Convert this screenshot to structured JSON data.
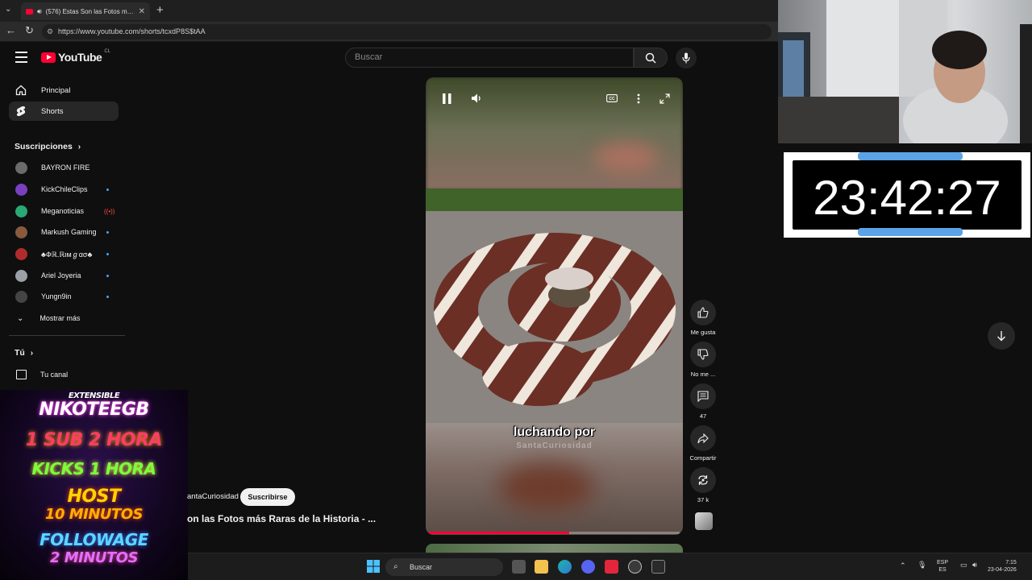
{
  "browser": {
    "tab_title": "(576) Estas Son las Fotos más Ra",
    "url": "https://www.youtube.com/shorts/tcxdP8S$tAA"
  },
  "header": {
    "logo_text": "YouTube",
    "country_code": "CL",
    "search_placeholder": "Buscar"
  },
  "sidebar": {
    "nav": [
      {
        "label": "Principal",
        "icon": "home-icon"
      },
      {
        "label": "Shorts",
        "icon": "shorts-icon",
        "active": true
      }
    ],
    "subscriptions_title": "Suscripciones",
    "subscriptions": [
      {
        "name": "BAYRON FIRE",
        "indicator": "none",
        "color": "#6b6b6b"
      },
      {
        "name": "KickChileClips",
        "indicator": "dot",
        "color": "#7a3fbf"
      },
      {
        "name": "Meganoticias",
        "indicator": "live",
        "color": "#2aa876"
      },
      {
        "name": "Markush Gaming",
        "indicator": "dot",
        "color": "#8a5a3c"
      },
      {
        "name": "♣Фℝ.ℝιмℊασ♣",
        "indicator": "dot",
        "color": "#b02c2c"
      },
      {
        "name": "Ariel Joyeria",
        "indicator": "dot",
        "color": "#9aa0a6"
      },
      {
        "name": "Yungn9in",
        "indicator": "dot",
        "color": "#444444"
      }
    ],
    "show_more": "Mostrar más",
    "you_title": "Tú",
    "your_channel": "Tu canal"
  },
  "promo": {
    "line1": "EXTENSIBLE",
    "line2": "NIKOTEEGB",
    "line3": "1 SUB 2 HORA",
    "line4": "KICKS 1 HORA",
    "line5": "HOST",
    "line6": "10 MINUTOS",
    "line7": "FOLLOWAGE",
    "line8": "2 MINUTOS"
  },
  "video": {
    "channel": "antaCuriosidad",
    "subscribe_label": "Suscribirse",
    "title": "on las Fotos más Raras de la Historia - ...",
    "caption": "luchando por",
    "watermark": "SantaCuriosidad",
    "progress": 0.56
  },
  "actions": {
    "like_label": "Me gusta",
    "dislike_label": "No me ...",
    "comments_count": "47",
    "share_label": "Compartir",
    "remix_count": "37 k"
  },
  "timer": {
    "value": "23:42:27"
  },
  "taskbar": {
    "search_label": "Buscar",
    "lang_line1": "ESP",
    "lang_line2": "ES",
    "time": "7:15",
    "date": "23-04-2026"
  },
  "colors": {
    "brand_red": "#ff0033",
    "accent_blue": "#3ea6ff",
    "timer_bar": "#5ba3e6"
  }
}
